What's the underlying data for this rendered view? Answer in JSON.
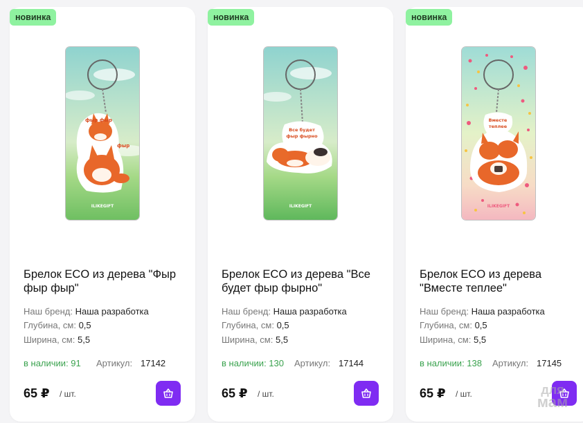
{
  "products": [
    {
      "badge": "новинка",
      "title": "Брелок ECO из дерева \"Фыр фыр фыр\"",
      "brand_label": "Наш бренд:",
      "brand_value": "Наша разработка",
      "depth_label": "Глубина, см:",
      "depth_value": "0,5",
      "width_label": "Ширина, см:",
      "width_value": "5,5",
      "stock": "в наличии: 91",
      "sku_label": "Артикул:",
      "sku_value": "17142",
      "price": "65 ₽",
      "unit": "/ шт.",
      "image": {
        "background": "sky-and-grass",
        "caption": "фыр фыр фыр",
        "brand_mark": "ILIKEGIFT"
      }
    },
    {
      "badge": "новинка",
      "title": "Брелок ECO из дерева \"Все будет фыр фырно\"",
      "brand_label": "Наш бренд:",
      "brand_value": "Наша разработка",
      "depth_label": "Глубина, см:",
      "depth_value": "0,5",
      "width_label": "Ширина, см:",
      "width_value": "5,5",
      "stock": "в наличии: 130",
      "sku_label": "Артикул:",
      "sku_value": "17144",
      "price": "65 ₽",
      "unit": "/ шт.",
      "image": {
        "background": "sky-and-grass",
        "caption": "Все будет фыр фырно",
        "brand_mark": "ILIKEGIFT"
      }
    },
    {
      "badge": "новинка",
      "title": "Брелок ECO из дерева \"Вместе теплее\"",
      "brand_label": "Наш бренд:",
      "brand_value": "Наша разработка",
      "depth_label": "Глубина, см:",
      "depth_value": "0,5",
      "width_label": "Ширина, см:",
      "width_value": "5,5",
      "stock": "в наличии: 138",
      "sku_label": "Артикул:",
      "sku_value": "17145",
      "price": "65 ₽",
      "unit": "/ шт.",
      "image": {
        "background": "hearts-and-stars",
        "caption": "Вместе теплее",
        "brand_mark": "ILIKEGIFT"
      }
    }
  ],
  "cart_button": {
    "icon": "basket-icon"
  },
  "watermark": {
    "line1": "для",
    "line2": "мам"
  },
  "colors": {
    "badge": "#8ff2a0",
    "accent": "#7f2cf2",
    "stock": "#3aa24e",
    "muted": "#777777",
    "background": "#f4f4f6"
  }
}
